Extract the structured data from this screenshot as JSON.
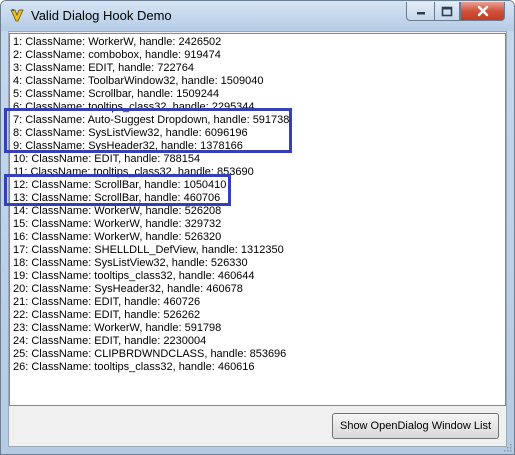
{
  "window": {
    "title": "Valid Dialog Hook Demo",
    "app_icon": "app-icon"
  },
  "caption_buttons": {
    "minimize_icon": "minimize-icon",
    "maximize_icon": "maximize-icon",
    "close_icon": "close-icon"
  },
  "list": {
    "items": [
      "1: ClassName: WorkerW, handle: 2426502",
      "2: ClassName: combobox, handle: 919474",
      "3: ClassName: EDIT, handle: 722764",
      "4: ClassName: ToolbarWindow32, handle: 1509040",
      "5: ClassName: Scrollbar, handle: 1509244",
      "6: ClassName: tooltips_class32, handle: 2295344",
      "7: ClassName: Auto-Suggest Dropdown, handle: 591738",
      "8: ClassName: SysListView32, handle: 6096196",
      "9: ClassName: SysHeader32, handle: 1378166",
      "10: ClassName: EDIT, handle: 788154",
      "11: ClassName: tooltips_class32, handle: 853690",
      "12: ClassName: ScrollBar, handle: 1050410",
      "13: ClassName: ScrollBar, handle: 460706",
      "14: ClassName: WorkerW, handle: 526208",
      "15: ClassName: WorkerW, handle: 329732",
      "16: ClassName: WorkerW, handle: 526320",
      "17: ClassName: SHELLDLL_DefView, handle: 1312350",
      "18: ClassName: SysListView32, handle: 526330",
      "19: ClassName: tooltips_class32, handle: 460644",
      "20: ClassName: SysHeader32, handle: 460678",
      "21: ClassName: EDIT, handle: 460726",
      "22: ClassName: EDIT, handle: 526262",
      "23: ClassName: WorkerW, handle: 591798",
      "24: ClassName: EDIT, handle: 2230004",
      "25: ClassName: CLIPBRDWNDCLASS, handle: 853696",
      "26: ClassName: tooltips_class32, handle: 460616"
    ]
  },
  "button": {
    "label": "Show OpenDialog Window List"
  },
  "colors": {
    "highlight_border": "#3340b8",
    "close_button": "#c8432b"
  }
}
